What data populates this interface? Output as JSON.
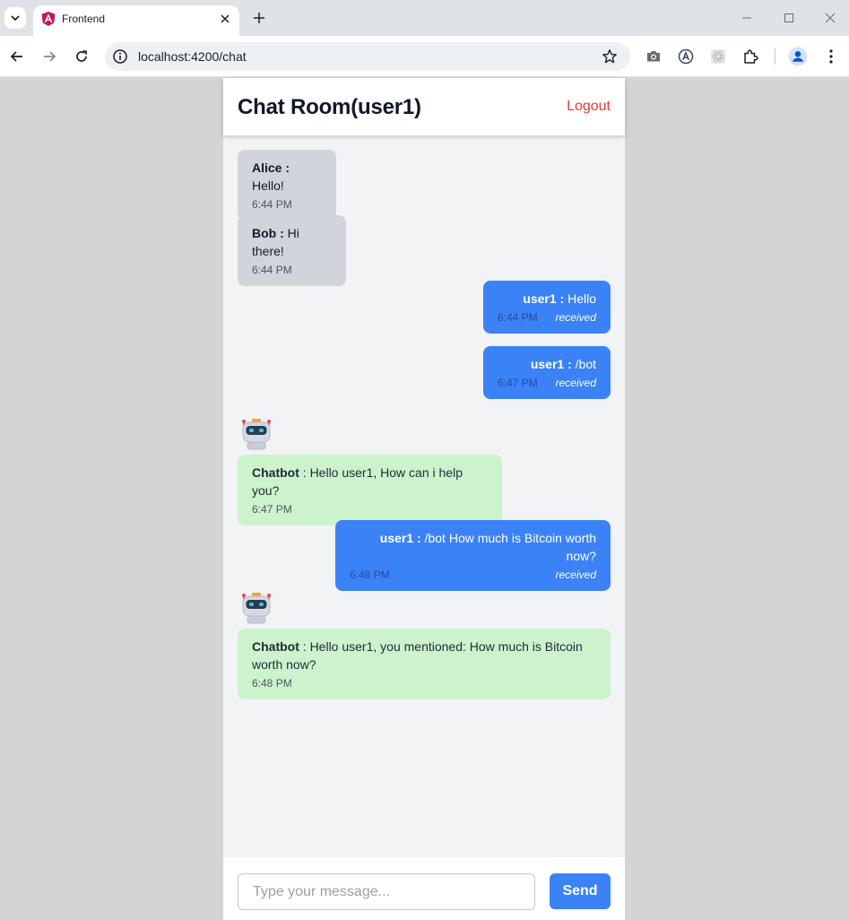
{
  "browser": {
    "tab_title": "Frontend",
    "url": "localhost:4200/chat"
  },
  "chat": {
    "title": "Chat Room(user1)",
    "logout_label": "Logout",
    "messages": [
      {
        "sender": "Alice",
        "separator": " : ",
        "text": "Hello!",
        "time": "6:44 PM",
        "type": "other"
      },
      {
        "sender": "Bob",
        "separator": " : ",
        "text": "Hi there!",
        "time": "6:44 PM",
        "type": "other"
      },
      {
        "sender": "user1",
        "separator": " : ",
        "text": "Hello",
        "time": "6:44 PM",
        "status": "received",
        "type": "mine"
      },
      {
        "sender": "user1",
        "separator": " : ",
        "text": "/bot",
        "time": "6:47 PM",
        "status": "received",
        "type": "mine"
      },
      {
        "sender": "Chatbot",
        "separator": " : ",
        "text": "Hello user1, How can i help you?",
        "time": "6:47 PM",
        "type": "bot"
      },
      {
        "sender": "user1 :",
        "separator": " ",
        "text": "/bot How much is Bitcoin worth now?",
        "time": "6:48 PM",
        "status": "received",
        "type": "mine"
      },
      {
        "sender": "Chatbot",
        "separator": " : ",
        "text": "Hello user1, you mentioned: How much is Bitcoin worth now?",
        "time": "6:48 PM",
        "type": "bot"
      }
    ],
    "input_placeholder": "Type your message...",
    "input_value": "",
    "send_label": "Send"
  },
  "icons": {
    "tab_search": "chevron-down-icon",
    "favicon": "angular-icon",
    "bot_avatar": "robot-icon"
  },
  "colors": {
    "own_bubble": "#3b82f6",
    "other_bubble": "#d1d5db",
    "bot_bubble": "#cdf3cd",
    "logout": "#e53935",
    "send_button": "#3b82f6"
  }
}
